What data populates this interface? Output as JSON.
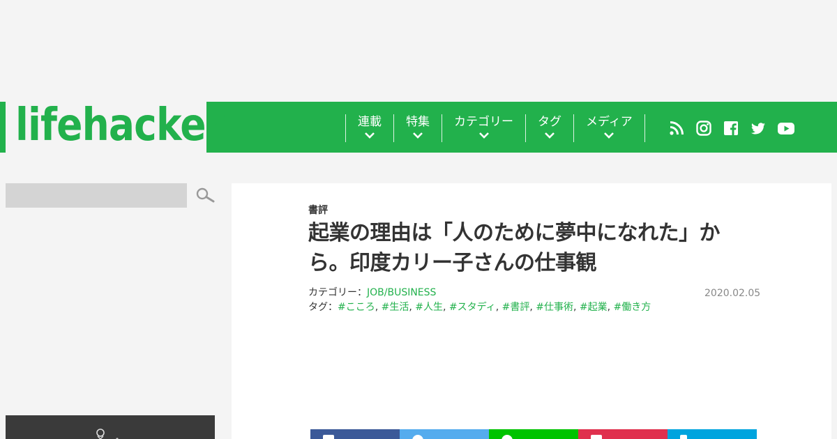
{
  "brand": {
    "logo_text": "lifehacker",
    "accent": "#22b14c"
  },
  "nav": {
    "items": [
      {
        "label": "連載"
      },
      {
        "label": "特集"
      },
      {
        "label": "カテゴリー"
      },
      {
        "label": "タグ"
      },
      {
        "label": "メディア"
      }
    ]
  },
  "social": [
    "rss-icon",
    "instagram-icon",
    "facebook-icon",
    "twitter-icon",
    "youtube-icon"
  ],
  "search": {
    "value": "",
    "placeholder": ""
  },
  "article": {
    "category_head": "書評",
    "title": "起業の理由は「人のために夢中になれた」から。印度カリー子さんの仕事観",
    "category_label": "カテゴリー：",
    "category_value": "JOB/BUSINESS",
    "tags_label": "タグ：",
    "tags": [
      "#こころ",
      "#生活",
      "#人生",
      "#スタディ",
      "#書評",
      "#仕事術",
      "#起業",
      "#働き方"
    ],
    "date": "2020.02.05"
  },
  "share_colors": [
    "#3b5998",
    "#55acee",
    "#00c300",
    "#e0304e",
    "#00a4de"
  ]
}
